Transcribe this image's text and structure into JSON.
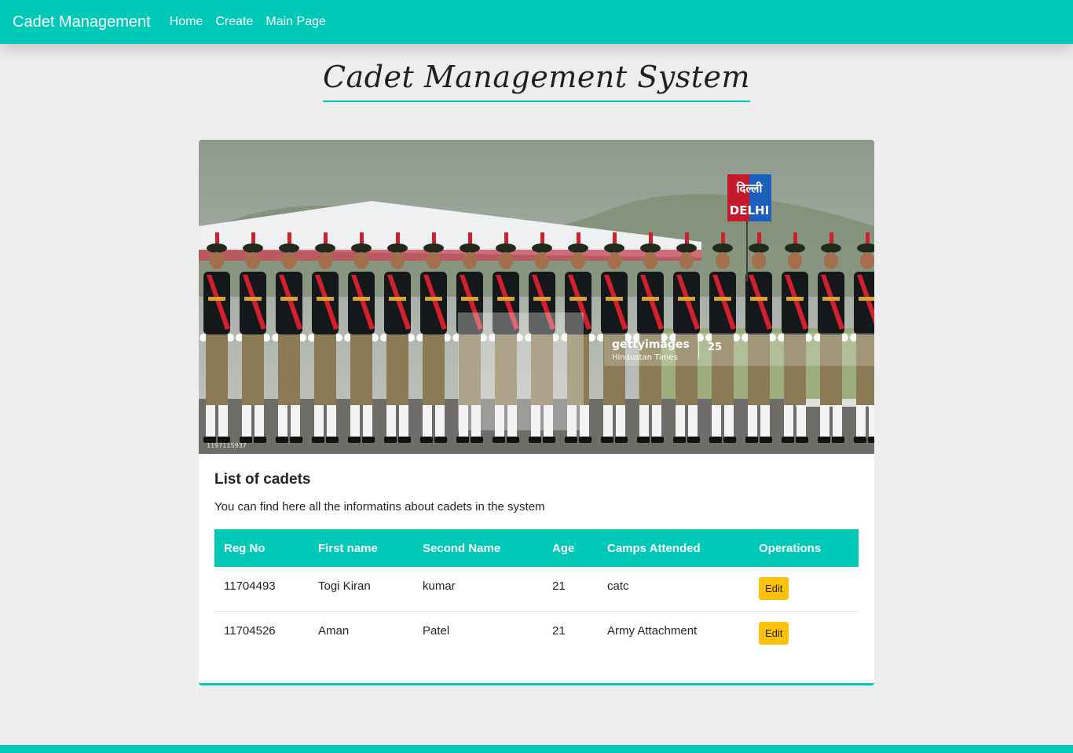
{
  "navbar": {
    "brand": "Cadet Management",
    "links": [
      "Home",
      "Create",
      "Main Page"
    ]
  },
  "page": {
    "title": "Cadet Management System"
  },
  "card": {
    "image": {
      "watermark_brand": "gettyimages",
      "watermark_credit": "Hindustan Times",
      "watermark_badge": "25",
      "image_id": "1197115937",
      "sign_hindi": "दिल्ली",
      "sign_text": "DELHI"
    },
    "title": "List of cadets",
    "text": "You can find here all the informatins about cadets in the system"
  },
  "table": {
    "headers": [
      "Reg No",
      "First name",
      "Second Name",
      "Age",
      "Camps Attended",
      "Operations"
    ],
    "rows": [
      {
        "reg_no": "11704493",
        "first_name": "Togi Kiran",
        "second_name": "kumar",
        "age": "21",
        "camps": "catc",
        "action": "Edit"
      },
      {
        "reg_no": "11704526",
        "first_name": "Aman",
        "second_name": "Patel",
        "age": "21",
        "camps": "Army Attachment",
        "action": "Edit"
      }
    ]
  },
  "colors": {
    "accent": "#00c9b7",
    "edit_button": "#ffc107",
    "background": "#eeeeee"
  }
}
